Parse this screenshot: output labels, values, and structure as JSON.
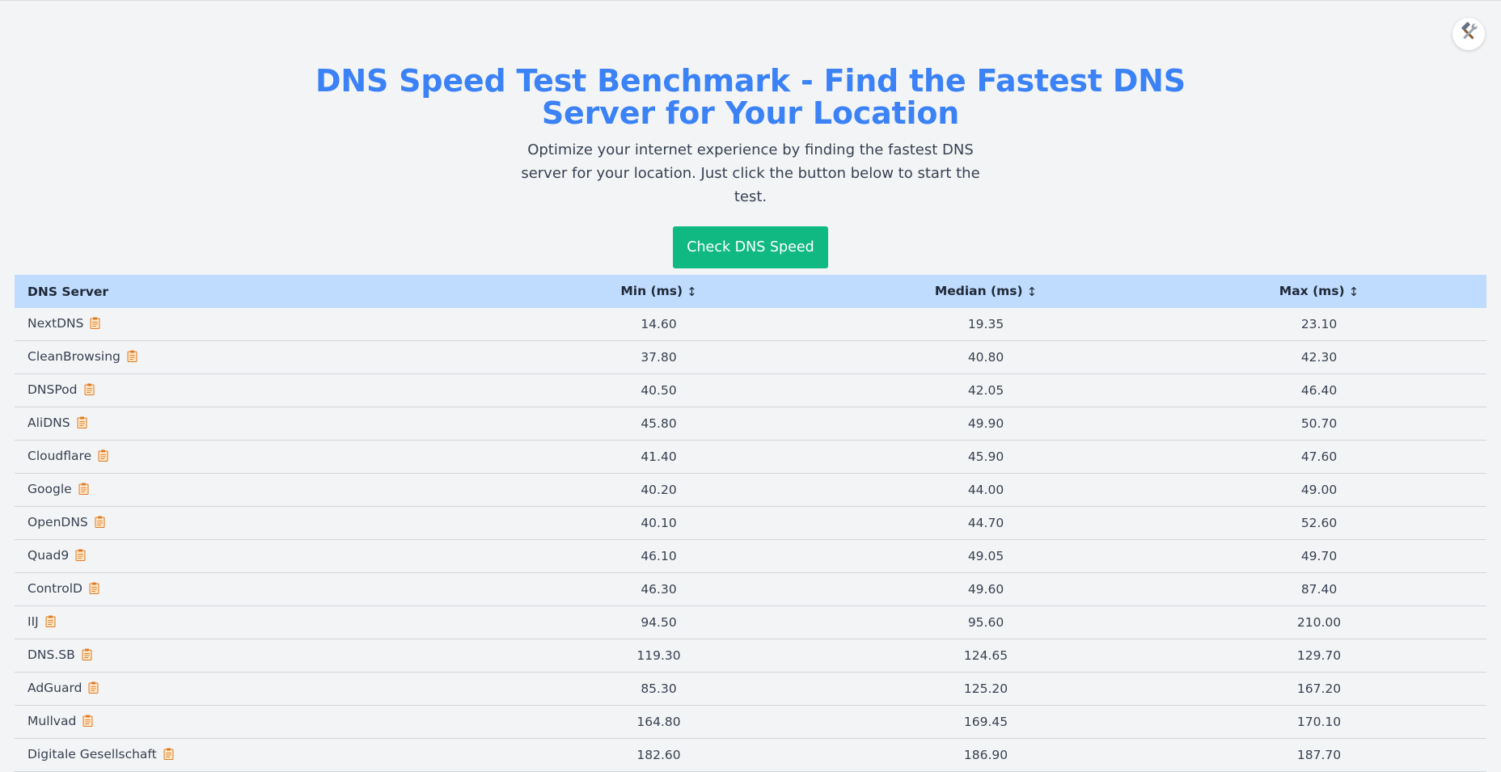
{
  "header": {
    "title": "DNS Speed Test Benchmark - Find the Fastest DNS Server for Your Location",
    "subtitle": "Optimize your internet experience by finding the fastest DNS server for your location. Just click the button below to start the test.",
    "check_button": "Check DNS Speed"
  },
  "settings": {
    "icon": "tools-icon"
  },
  "table": {
    "headers": {
      "server": "DNS Server",
      "min": "Min (ms)",
      "median": "Median (ms)",
      "max": "Max (ms)",
      "sort_icon": "↕"
    },
    "rows": [
      {
        "server": "NextDNS",
        "min": "14.60",
        "median": "19.35",
        "max": "23.10"
      },
      {
        "server": "CleanBrowsing",
        "min": "37.80",
        "median": "40.80",
        "max": "42.30"
      },
      {
        "server": "DNSPod",
        "min": "40.50",
        "median": "42.05",
        "max": "46.40"
      },
      {
        "server": "AliDNS",
        "min": "45.80",
        "median": "49.90",
        "max": "50.70"
      },
      {
        "server": "Cloudflare",
        "min": "41.40",
        "median": "45.90",
        "max": "47.60"
      },
      {
        "server": "Google",
        "min": "40.20",
        "median": "44.00",
        "max": "49.00"
      },
      {
        "server": "OpenDNS",
        "min": "40.10",
        "median": "44.70",
        "max": "52.60"
      },
      {
        "server": "Quad9",
        "min": "46.10",
        "median": "49.05",
        "max": "49.70"
      },
      {
        "server": "ControlD",
        "min": "46.30",
        "median": "49.60",
        "max": "87.40"
      },
      {
        "server": "IIJ",
        "min": "94.50",
        "median": "95.60",
        "max": "210.00"
      },
      {
        "server": "DNS.SB",
        "min": "119.30",
        "median": "124.65",
        "max": "129.70"
      },
      {
        "server": "AdGuard",
        "min": "85.30",
        "median": "125.20",
        "max": "167.20"
      },
      {
        "server": "Mullvad",
        "min": "164.80",
        "median": "169.45",
        "max": "170.10"
      },
      {
        "server": "Digitale Gesellschaft",
        "min": "182.60",
        "median": "186.90",
        "max": "187.70"
      }
    ]
  }
}
